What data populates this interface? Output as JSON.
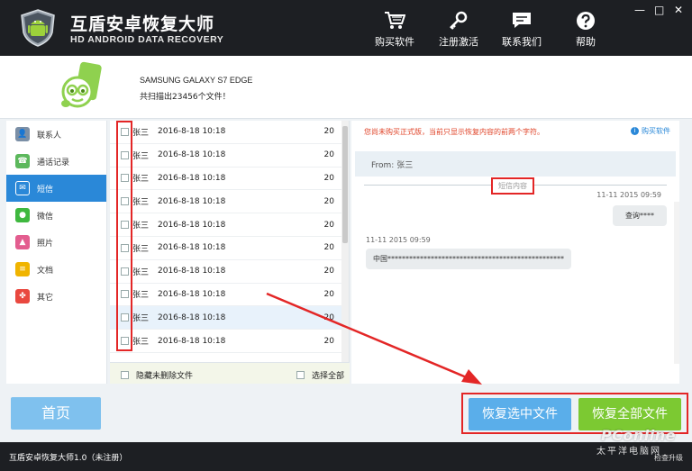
{
  "app": {
    "title": "互盾安卓恢复大师",
    "subtitle": "HD ANDROID DATA RECOVERY",
    "version_text": "互盾安卓恢复大师1.0（未注册）",
    "upgrade_text": "检查升级"
  },
  "toolbar": {
    "items": [
      {
        "label": "购买软件",
        "icon": "cart-icon"
      },
      {
        "label": "注册激活",
        "icon": "key-icon"
      },
      {
        "label": "联系我们",
        "icon": "chat-icon"
      },
      {
        "label": "帮助",
        "icon": "help-icon"
      }
    ],
    "window": {
      "minimize": "—",
      "maximize": "□",
      "close": "✕"
    }
  },
  "device": {
    "name": "SAMSUNG GALAXY S7 EDGE",
    "scan_text": "共扫描出23456个文件！"
  },
  "sidebar": {
    "items": [
      {
        "label": "联系人",
        "icon": "contacts-icon",
        "color": "#7b8fa6"
      },
      {
        "label": "通话记录",
        "icon": "phone-icon",
        "color": "#5cb85c"
      },
      {
        "label": "短信",
        "icon": "sms-icon",
        "color": "#ffffff",
        "active": true
      },
      {
        "label": "微信",
        "icon": "wechat-icon",
        "color": "#3fb83f"
      },
      {
        "label": "照片",
        "icon": "photo-icon",
        "color": "#e35d8f"
      },
      {
        "label": "文档",
        "icon": "document-icon",
        "color": "#f0b400"
      },
      {
        "label": "其它",
        "icon": "other-icon",
        "color": "#e9483f"
      }
    ]
  },
  "messages": {
    "rows": [
      {
        "name": "张三",
        "date": "2016-8-18 10:18",
        "count": "20"
      },
      {
        "name": "张三",
        "date": "2016-8-18 10:18",
        "count": "20"
      },
      {
        "name": "张三",
        "date": "2016-8-18 10:18",
        "count": "20"
      },
      {
        "name": "张三",
        "date": "2016-8-18 10:18",
        "count": "20"
      },
      {
        "name": "张三",
        "date": "2016-8-18 10:18",
        "count": "20"
      },
      {
        "name": "张三",
        "date": "2016-8-18 10:18",
        "count": "20"
      },
      {
        "name": "张三",
        "date": "2016-8-18 10:18",
        "count": "20"
      },
      {
        "name": "张三",
        "date": "2016-8-18 10:18",
        "count": "20"
      },
      {
        "name": "张三",
        "date": "2016-8-18 10:18",
        "count": "20",
        "selected": true
      },
      {
        "name": "张三",
        "date": "2016-8-18 10:18",
        "count": "20"
      }
    ],
    "hide_undeleted": "隐藏未删除文件",
    "select_all": "选择全部"
  },
  "detail": {
    "notice": "您尚未购买正式版，当前只显示恢复内容的前两个字符。",
    "buy_link": "购买软件",
    "from": "From: 张三",
    "section_label": "短信内容",
    "msg1_time": "11-11  2015  09:59",
    "msg1_text": "查询****",
    "msg2_time": "11-11  2015  09:59",
    "msg2_text": "中国*************************************************"
  },
  "buttons": {
    "home": "首页",
    "recover_selected": "恢复选中文件",
    "recover_all": "恢复全部文件"
  },
  "watermark": {
    "brand": "PConline",
    "cn": "太平洋电脑网"
  },
  "colors": {
    "accent_blue": "#2a88d8",
    "accent_green": "#7cc932",
    "annotation_red": "#e32626"
  }
}
